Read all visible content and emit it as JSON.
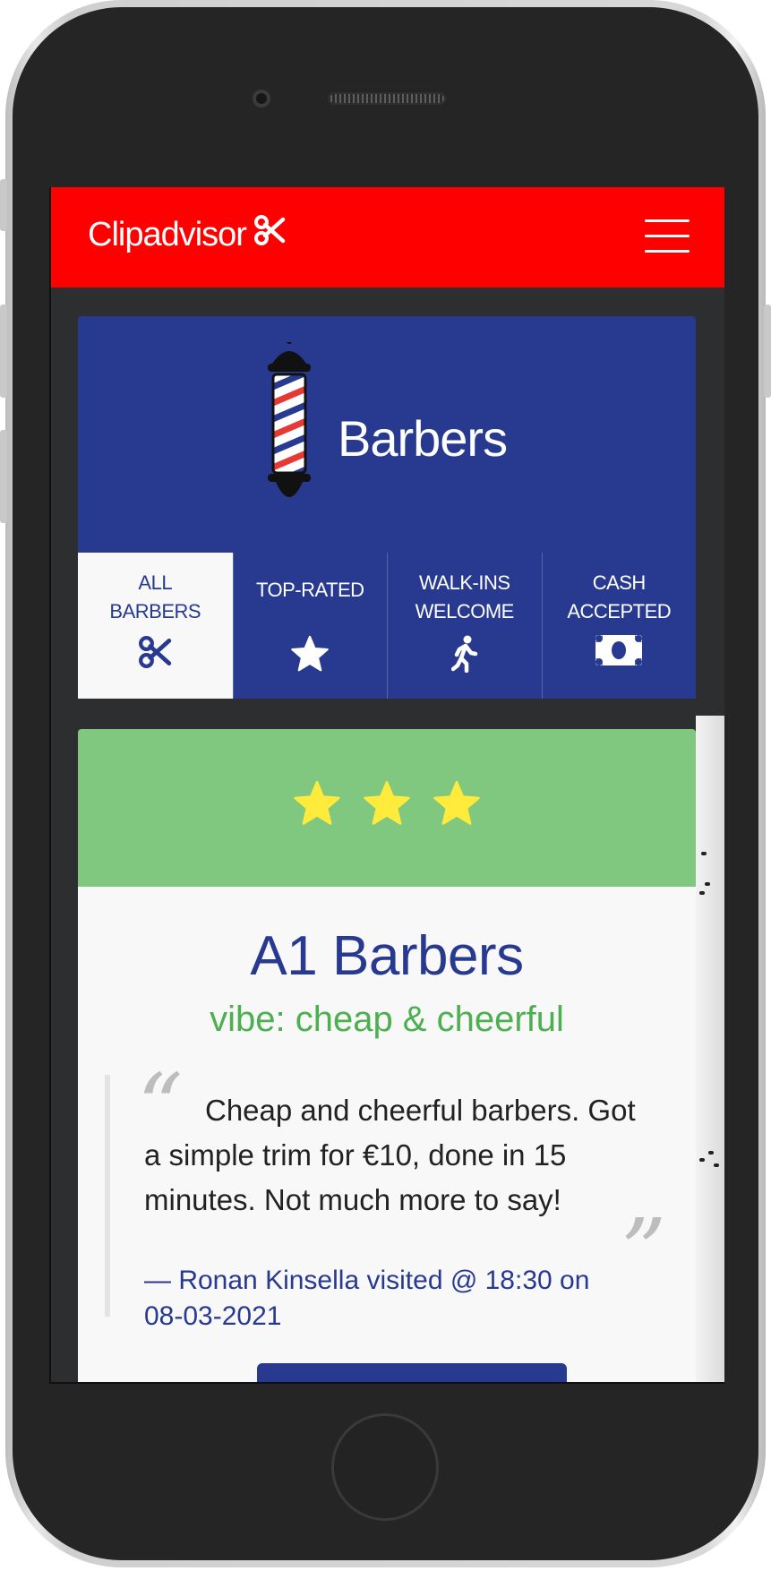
{
  "app": {
    "brand": "Clipadvisor",
    "colors": {
      "navbar": "#ff0000",
      "primary": "#283a8f",
      "success_bar": "#80c780",
      "vibe": "#4caf50",
      "star": "#ffeb3b"
    }
  },
  "navbar": {
    "menu_icon": "hamburger-menu-icon",
    "brand_icon": "scissors-icon"
  },
  "banner": {
    "title": "Barbers",
    "icon": "barber-pole-icon"
  },
  "tabs": [
    {
      "label": "ALL\nBARBERS",
      "icon": "scissors-icon",
      "active": true
    },
    {
      "label": "TOP-RATED",
      "icon": "star-icon",
      "active": false
    },
    {
      "label": "WALK-INS\nWELCOME",
      "icon": "walking-person-icon",
      "active": false
    },
    {
      "label": "CASH\nACCEPTED",
      "icon": "banknote-icon",
      "active": false
    }
  ],
  "listing": {
    "rating": 3,
    "name": "A1 Barbers",
    "vibe": "vibe: cheap & cheerful",
    "review": "Cheap and cheerful barbers. Got a simple trim for €10, done in 15 minutes. Not much more to say!",
    "reviewer_line": "—  Ronan Kinsella visited @ 18:30 on 08-03-2021"
  }
}
